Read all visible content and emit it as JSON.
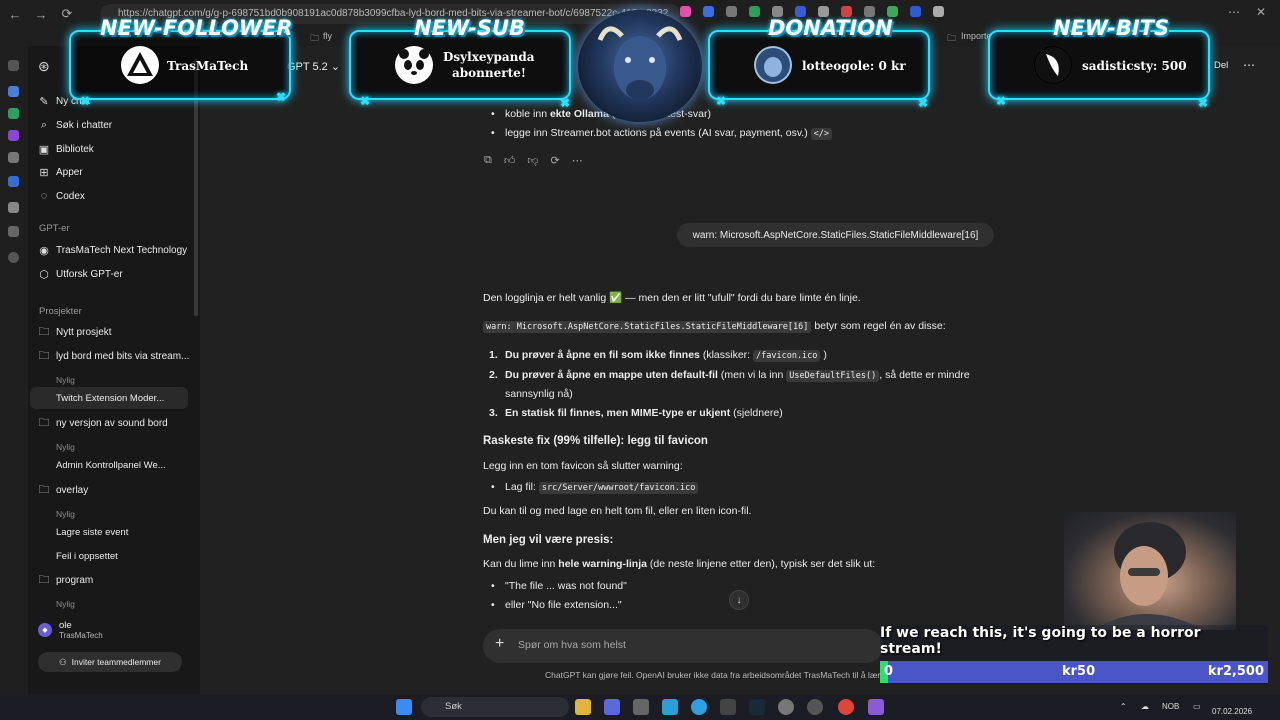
{
  "browser": {
    "url": "https://chatgpt.com/g/g-p-698751bd0b908191ac0d878b3099cfba-lyd-bord-med-bits-via-streamer-bot/c/6987522c-418e-8332",
    "bookmark_fly": "fly",
    "bookmark_import": "Importe"
  },
  "header": {
    "model": "GPT 5.2",
    "share": "Del"
  },
  "sidebar": {
    "new_chat": "Ny chat",
    "search": "Søk i chatter",
    "library": "Bibliotek",
    "apps": "Apper",
    "codex": "Codex",
    "gpts_heading": "GPT-er",
    "gpt_item": "TrasMaTech Next Technology",
    "explore_gpts": "Utforsk GPT-er",
    "projects_heading": "Prosjekter",
    "new_project": "Nytt prosjekt",
    "project1": "lyd bord med bits via stream...",
    "recent1": "Nylig",
    "p1_chat": "Twitch Extension Moder...",
    "project2": "ny versjon av sound bord",
    "recent2": "Nylig",
    "p2_chat": "Admin Kontrollpanel We...",
    "project3": "overlay",
    "recent3": "Nylig",
    "p3_chat1": "Lagre siste event",
    "p3_chat2": "Feil i oppsettet",
    "project4": "program",
    "recent4": "Nylig",
    "user_name": "ole",
    "user_org": "TrasMaTech",
    "invite": "Inviter teammedlemmer"
  },
  "chat": {
    "prev_bullet1_pre": "koble inn ",
    "prev_bullet1_bold": "ekte Ollama",
    "prev_bullet1_post": " (i stedet for test-svar)",
    "prev_bullet2": "legge inn Streamer.bot actions på events (AI svar, payment, osv.)",
    "user_message": "warn: Microsoft.AspNetCore.StaticFiles.StaticFileMiddleware[16]",
    "intro": "Den logglinja er helt vanlig ✅ — men den er litt \"ufull\" fordi du bare limte én linje.",
    "code_warn": "warn: Microsoft.AspNetCore.StaticFiles.StaticFileMiddleware[16]",
    "warn_after": " betyr som regel én av disse:",
    "item1_bold": "Du prøver å åpne en fil som ikke finnes",
    "item1_text": " (klassiker: ",
    "item1_code": "/favicon.ico",
    "item1_end": " )",
    "item2_bold": "Du prøver å åpne en mappe uten default-fil",
    "item2_text": " (men vi la inn ",
    "item2_code": "UseDefaultFiles()",
    "item2_end": ", så dette er mindre",
    "item2_line2": "sannsynlig nå)",
    "item3_bold": "En statisk fil finnes, men MIME-type er ukjent",
    "item3_text": " (sjeldnere)",
    "h_fix": "Raskeste fix (99% tilfelle): legg til favicon",
    "fix_text": "Legg inn en tom favicon så slutter warning:",
    "fix_bullet_pre": "Lag fil: ",
    "fix_code": "src/Server/wwwroot/favicon.ico",
    "fix_after": "Du kan til og med lage en helt tom fil, eller en liten icon-fil.",
    "h_precise": "Men jeg vil være presis:",
    "precise_pre": "Kan du lime inn ",
    "precise_bold": "hele warning-linja",
    "precise_post": " (de neste linjene etter den), typisk ser det slik ut:",
    "q1": "\"The file ... was not found\"",
    "q2": "eller \"No file extension...\""
  },
  "composer": {
    "placeholder": "Spør om hva som helst",
    "disclaimer": "ChatGPT kan gjøre feil. OpenAI bruker ikke data fra arbeidsområdet TrasMaTech til å lære opp m"
  },
  "overlay": {
    "follower_title": "NEW-FOLLOWER",
    "follower_name": "TrasMaTech",
    "sub_title": "NEW-SUB",
    "sub_line1": "Dsylxeypanda",
    "sub_line2": "abonnerte!",
    "donation_title": "DONATION",
    "donation_text": "lotteogole: 0 kr",
    "bits_title": "NEW-BITS",
    "bits_text": "sadisticsty: 500",
    "goal_text": "If we reach this, it's going to be a horror stream!",
    "goal_start": "0",
    "goal_mid": "kr50",
    "goal_end": "kr2,500",
    "goal_progress": 0.02
  },
  "taskbar": {
    "search": "Søk",
    "lang": "NOB",
    "date": "07.02.2026"
  },
  "colors": {
    "accent": "#29e0ff",
    "goal_bar": "#4a55c8",
    "goal_fill": "#2ee06a"
  }
}
